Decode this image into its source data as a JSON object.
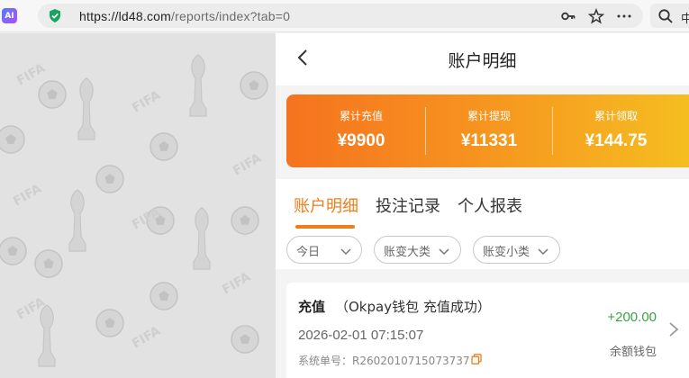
{
  "browser": {
    "url_host": "https://ld48.com",
    "url_path": "/reports/index?tab=0",
    "search_label": "中"
  },
  "page": {
    "title": "账户明细"
  },
  "summary": {
    "items": [
      {
        "label": "累计充值",
        "value": "¥9900"
      },
      {
        "label": "累计提现",
        "value": "¥11331"
      },
      {
        "label": "累计领取",
        "value": "¥144.75"
      }
    ]
  },
  "tabs": [
    {
      "label": "账户明细",
      "active": true
    },
    {
      "label": "投注记录",
      "active": false
    },
    {
      "label": "个人报表",
      "active": false
    }
  ],
  "filters": [
    {
      "label": "今日"
    },
    {
      "label": "账变大类"
    },
    {
      "label": "账变小类"
    }
  ],
  "records": [
    {
      "type": "充值",
      "description": "（Okpay钱包 充值成功）",
      "time": "2026-02-01 07:15:07",
      "order_label": "系统单号：R2602010715073737",
      "amount": "+200.00",
      "wallet": "余额钱包"
    }
  ],
  "colors": {
    "accent": "#f07d1a",
    "gradient_start": "#f5731f",
    "gradient_end": "#f5c020",
    "positive": "#3ba043"
  }
}
